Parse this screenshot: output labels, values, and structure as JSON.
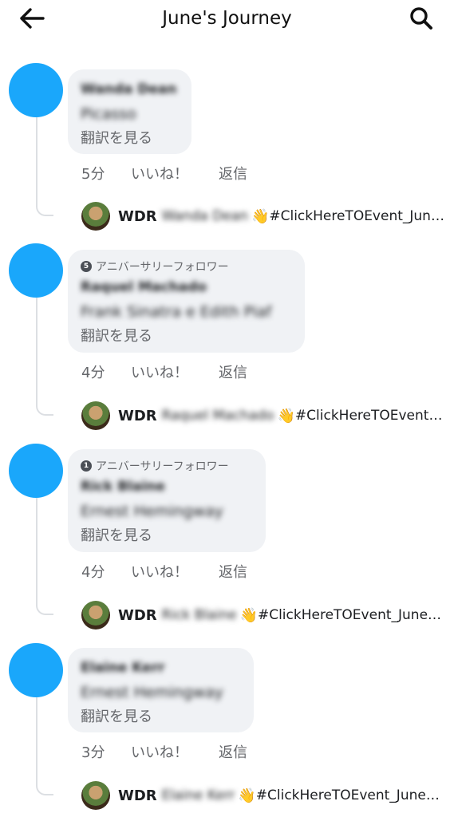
{
  "header": {
    "title": "June's Journey",
    "back_icon": "arrow-left-icon",
    "search_icon": "search-icon"
  },
  "colors": {
    "avatar": "#1aa7fb",
    "bubble": "#f0f2f5",
    "meta_text": "#65676b"
  },
  "threads": [
    {
      "badge": "",
      "badge_number": "",
      "author": "Wanda Dean",
      "text": "Picasso",
      "translate": "翻訳を見る",
      "time": "5分",
      "like": "いいね！",
      "reply": "返信",
      "reply_preview": {
        "name": "WDR",
        "mention": "Wanda Dean",
        "emoji": "👋",
        "text": "#ClickHereTOEvent_Jun…"
      }
    },
    {
      "badge": "アニバーサリーフォロワー",
      "badge_number": "5",
      "author": "Raquel Machado",
      "text": "Frank Sinatra e Edith Piaf",
      "translate": "翻訳を見る",
      "time": "4分",
      "like": "いいね！",
      "reply": "返信",
      "reply_preview": {
        "name": "WDR",
        "mention": "Raquel Machado",
        "emoji": "👋",
        "text": "#ClickHereTOEvent…"
      }
    },
    {
      "badge": "アニバーサリーフォロワー",
      "badge_number": "1",
      "author": "Rick Blaine",
      "text": "Ernest Hemingway",
      "translate": "翻訳を見る",
      "time": "4分",
      "like": "いいね！",
      "reply": "返信",
      "reply_preview": {
        "name": "WDR",
        "mention": "Rick Blaine",
        "emoji": "👋",
        "text": "#ClickHereTOEvent_June…"
      }
    },
    {
      "badge": "",
      "badge_number": "",
      "author": "Elaine Kerr",
      "text": "Ernest Hemingway",
      "translate": "翻訳を見る",
      "time": "3分",
      "like": "いいね！",
      "reply": "返信",
      "reply_preview": {
        "name": "WDR",
        "mention": "Elaine Kerr",
        "emoji": "👋",
        "text": "#ClickHereTOEvent_June…"
      }
    }
  ]
}
